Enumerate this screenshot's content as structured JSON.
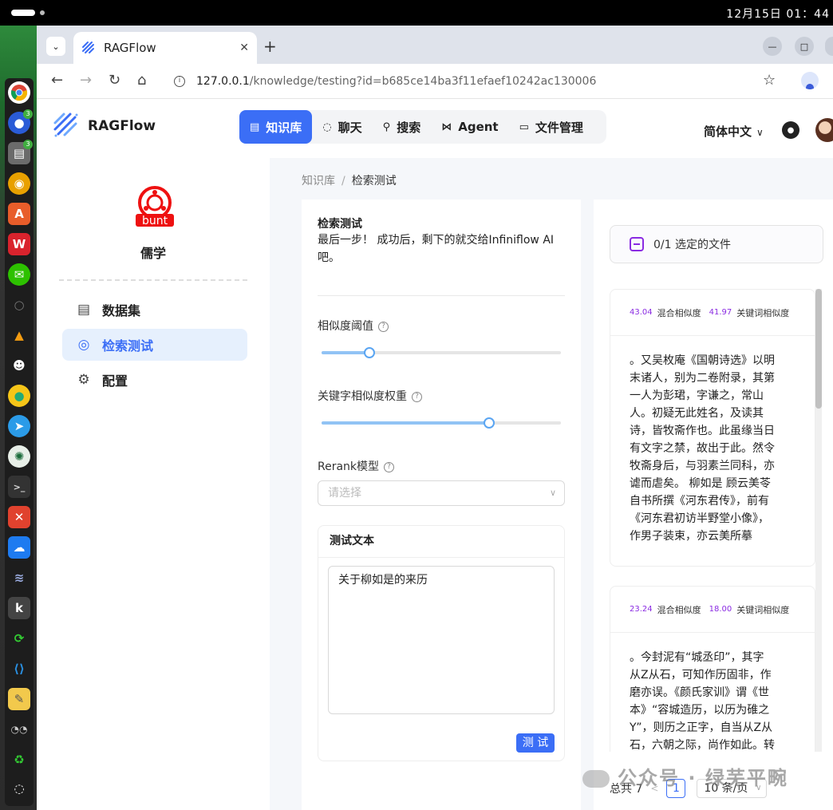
{
  "system": {
    "clock": "12月15日 01：44"
  },
  "browser": {
    "tab_title": "RAGFlow",
    "url_host": "127.0.0.1",
    "url_path": "/knowledge/testing?id=b685ce14ba3f11efaef10242ac130006"
  },
  "header": {
    "brand": "RAGFlow",
    "nav": [
      {
        "label": "知识库",
        "icon": "database-icon"
      },
      {
        "label": "聊天",
        "icon": "chat-icon"
      },
      {
        "label": "搜索",
        "icon": "search-icon"
      },
      {
        "label": "Agent",
        "icon": "agent-graph-icon"
      },
      {
        "label": "文件管理",
        "icon": "folder-icon"
      }
    ],
    "language": "简体中文"
  },
  "sidebar": {
    "kb_name": "儒学",
    "kb_icon_text": "bunt",
    "items": [
      {
        "label": "数据集",
        "icon": "document-icon"
      },
      {
        "label": "检索测试",
        "icon": "target-icon"
      },
      {
        "label": "配置",
        "icon": "gear-icon"
      }
    ]
  },
  "breadcrumb": {
    "root": "知识库",
    "sep": "/",
    "current": "检索测试"
  },
  "testing": {
    "title": "检索测试",
    "desc": "最后一步！ 成功后，剩下的就交给Infiniflow AI吧。",
    "similarity_label": "相似度阈值",
    "similarity_value": 0.2,
    "keyword_weight_label": "关键字相似度权重",
    "keyword_weight_value": 0.7,
    "rerank_label": "Rerank模型",
    "rerank_placeholder": "请选择",
    "test_text_title": "测试文本",
    "test_text_value": "关于柳如是的来历",
    "run_button": "测 试"
  },
  "results": {
    "file_select": "0/1 选定的文件",
    "cards": [
      {
        "hybrid_score": "43.04",
        "hybrid_label": "混合相似度",
        "keyword_score": "41.97",
        "keyword_label": "关键词相似度",
        "text": "。又吴枚庵《国朝诗选》以明末诸人，别为二卷附录，其第一人为彭珺，字谦之，常山人。初疑无此姓名，及读其诗，皆牧斋作也。此虽缘当日有文字之禁，故出于此。然令牧斋身后，与羽素兰同科，亦谑而虐矣。                  柳如是        顾云美苓自书所撰《河东君传》，前有《河东君初访半野堂小像》，作男子装束，亦云美所摹"
      },
      {
        "hybrid_score": "23.24",
        "hybrid_label": "混合相似度",
        "keyword_score": "18.00",
        "keyword_label": "关键词相似度",
        "text": "。今封泥有“城丞印”，其字从Z从石，可知作历固非，作磨亦误。《颜氏家训》谓《世本》“容城造历，以历为碓之Y”，则历之正字，自当从Z从石，六朝之际，尚作如此。转讹作磨，事乃有因，"
      }
    ],
    "total": "总共 7",
    "current_page": "1",
    "page_size": "10 条/页"
  },
  "watermark": "公众号 · 绿芜平畹"
}
